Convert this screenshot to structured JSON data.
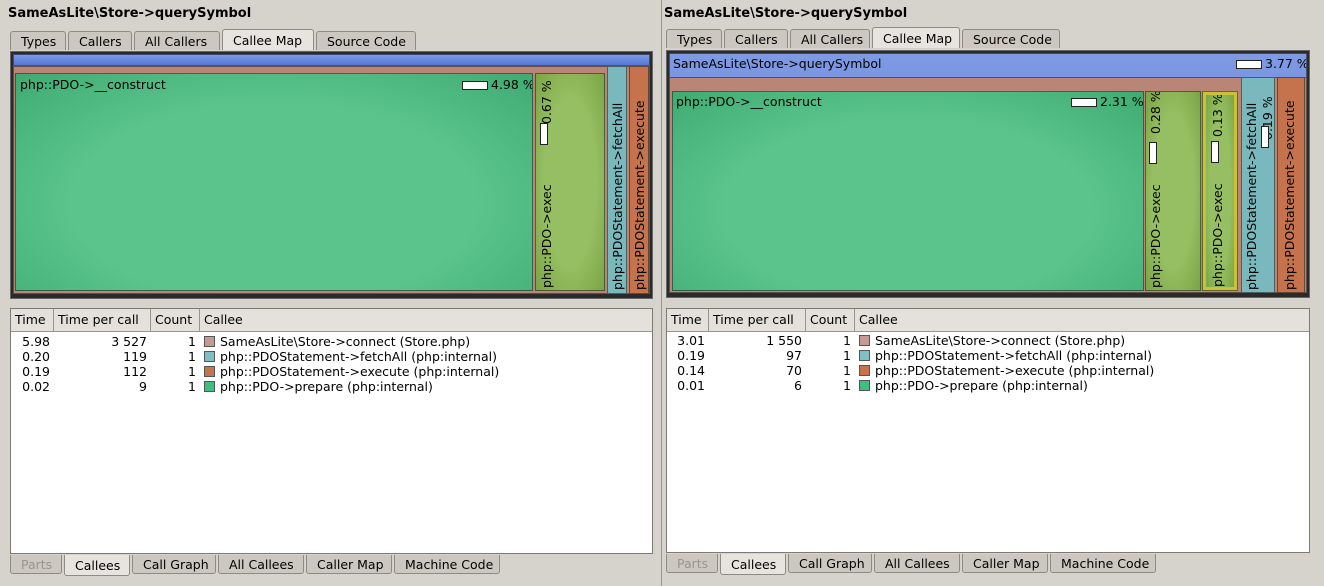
{
  "panels": [
    {
      "title": "SameAsLite\\Store->querySymbol",
      "tabs": [
        "Types",
        "Callers",
        "All Callers",
        "Callee Map",
        "Source Code"
      ],
      "active_tab": 3,
      "map": {
        "root_label": "",
        "root_pct": "",
        "main_label": "php::PDO->__construct",
        "main_pct": "4.98 %",
        "exec_label": "php::PDO->exec",
        "exec_pct": "0.67 %",
        "prepare_label": "",
        "prepare_pct": "",
        "fetch_label": "php::PDOStatement->fetchAll",
        "fetch_pct": "",
        "execute_label": "php::PDOStatement->execute"
      },
      "columns": [
        "Time",
        "Time per call",
        "Count",
        "Callee"
      ],
      "rows": [
        {
          "time": "5.98",
          "per_call": "3 527",
          "count": "1",
          "color": "#c49a93",
          "callee": "SameAsLite\\Store->connect (Store.php)"
        },
        {
          "time": "0.20",
          "per_call": "119",
          "count": "1",
          "color": "#7fbfc2",
          "callee": "php::PDOStatement->fetchAll (php:internal)"
        },
        {
          "time": "0.19",
          "per_call": "112",
          "count": "1",
          "color": "#c4734d",
          "callee": "php::PDOStatement->execute (php:internal)"
        },
        {
          "time": "0.02",
          "per_call": "9",
          "count": "1",
          "color": "#3fbf7f",
          "callee": "php::PDO->prepare (php:internal)"
        }
      ],
      "bottom_tabs": [
        "Parts",
        "Callees",
        "Call Graph",
        "All Callees",
        "Caller Map",
        "Machine Code"
      ],
      "bottom_active": 1
    },
    {
      "title": "SameAsLite\\Store->querySymbol",
      "tabs": [
        "Types",
        "Callers",
        "All Callers",
        "Callee Map",
        "Source Code"
      ],
      "active_tab": 3,
      "map": {
        "root_label": "SameAsLite\\Store->querySymbol",
        "root_pct": "3.77 %",
        "main_label": "php::PDO->__construct",
        "main_pct": "2.31 %",
        "exec_label": "php::PDO->exec",
        "exec_pct": "0.28 %",
        "prepare_label": "php::PDO->exec",
        "prepare_pct": "0.13 %",
        "fetch_label": "php::PDOStatement->fetchAll",
        "fetch_pct": "0.19 %",
        "execute_label": "php::PDOStatement->execute"
      },
      "columns": [
        "Time",
        "Time per call",
        "Count",
        "Callee"
      ],
      "rows": [
        {
          "time": "3.01",
          "per_call": "1 550",
          "count": "1",
          "color": "#c49a93",
          "callee": "SameAsLite\\Store->connect (Store.php)"
        },
        {
          "time": "0.19",
          "per_call": "97",
          "count": "1",
          "color": "#7fbfc2",
          "callee": "php::PDOStatement->fetchAll (php:internal)"
        },
        {
          "time": "0.14",
          "per_call": "70",
          "count": "1",
          "color": "#c4734d",
          "callee": "php::PDOStatement->execute (php:internal)"
        },
        {
          "time": "0.01",
          "per_call": "6",
          "count": "1",
          "color": "#3fbf7f",
          "callee": "php::PDO->prepare (php:internal)"
        }
      ],
      "bottom_tabs": [
        "Parts",
        "Callees",
        "Call Graph",
        "All Callees",
        "Caller Map",
        "Machine Code"
      ],
      "bottom_active": 1
    }
  ]
}
